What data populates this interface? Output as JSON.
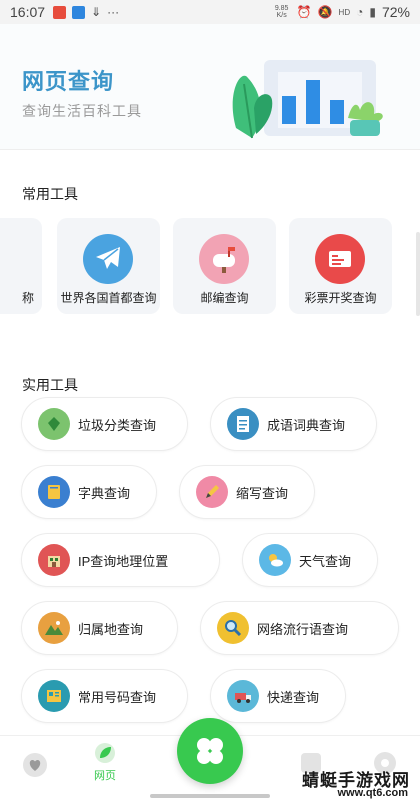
{
  "status_bar": {
    "time": "16:07",
    "net_speed": "9.85 K/s",
    "hd": "HD",
    "battery": "72%"
  },
  "header": {
    "title": "网页查询",
    "subtitle": "查询生活百科工具"
  },
  "sections": {
    "common": "常用工具",
    "practical": "实用工具"
  },
  "common_tools": [
    {
      "label": "称",
      "icon": "partial-card-icon"
    },
    {
      "label": "世界各国首都查询",
      "icon": "airplane-icon",
      "color": "#4aa3e0"
    },
    {
      "label": "邮编查询",
      "icon": "mailbox-icon",
      "color": "#f2a3b4"
    },
    {
      "label": "彩票开奖查询",
      "icon": "lottery-icon",
      "color": "#e94a4a"
    }
  ],
  "practical_tools": [
    {
      "label": "垃圾分类查询",
      "icon": "recycle-icon",
      "color": "#7cc36e"
    },
    {
      "label": "成语词典查询",
      "icon": "document-icon",
      "color": "#3a8fc2"
    },
    {
      "label": "字典查询",
      "icon": "book-icon",
      "color": "#3a7fd0"
    },
    {
      "label": "缩写查询",
      "icon": "pencil-icon",
      "color": "#f08aa6"
    },
    {
      "label": "IP查询地理位置",
      "icon": "building-icon",
      "color": "#e05555"
    },
    {
      "label": "天气查询",
      "icon": "weather-icon",
      "color": "#5cb8e6"
    },
    {
      "label": "归属地查询",
      "icon": "landscape-icon",
      "color": "#e8a040"
    },
    {
      "label": "网络流行语查询",
      "icon": "magnifier-icon",
      "color": "#f0c030"
    },
    {
      "label": "常用号码查询",
      "icon": "phone-book-icon",
      "color": "#2a9bb0"
    },
    {
      "label": "快递查询",
      "icon": "delivery-truck-icon",
      "color": "#5bb8d8"
    }
  ],
  "bottom_nav": {
    "web_label": "网页",
    "active_color": "#38c94f"
  },
  "watermark": {
    "text": "蜻蜓手游戏网",
    "url": "www.qt6.com"
  }
}
